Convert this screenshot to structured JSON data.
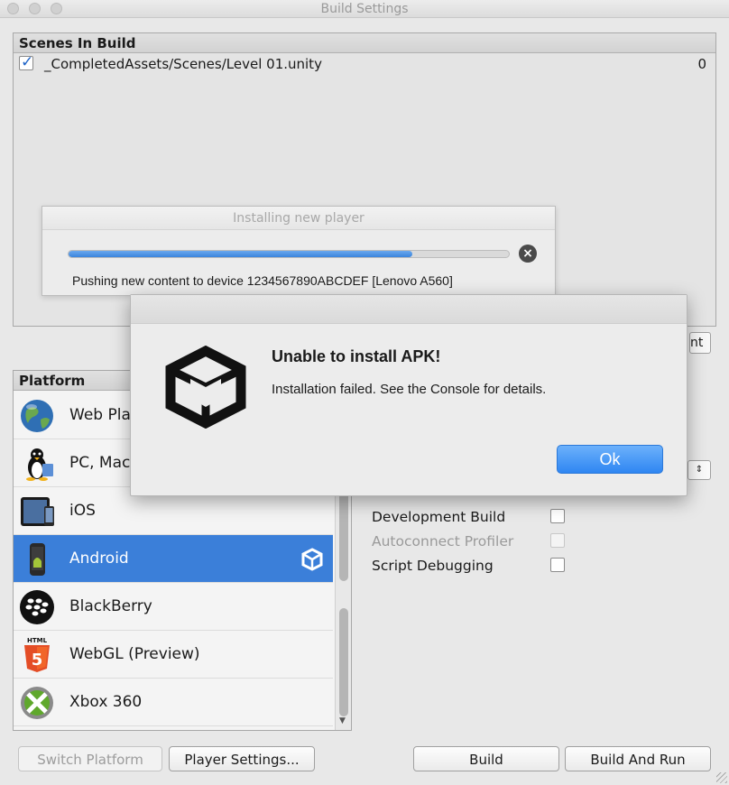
{
  "window": {
    "title": "Build Settings"
  },
  "scenes": {
    "header": "Scenes In Build",
    "items": [
      {
        "path": "_CompletedAssets/Scenes/Level 01.unity",
        "index": "0",
        "checked": true
      }
    ]
  },
  "progress_dialog": {
    "title": "Installing new player",
    "message": "Pushing new content to device 1234567890ABCDEF [Lenovo A560]",
    "progress_percent": 78
  },
  "platform": {
    "header": "Platform",
    "items": [
      {
        "label": "Web Pla",
        "icon": "globe-icon"
      },
      {
        "label": "PC, Mac",
        "icon": "penguin-icon"
      },
      {
        "label": "iOS",
        "icon": "ipad-icon"
      },
      {
        "label": "Android",
        "icon": "android-phone-icon",
        "selected": true
      },
      {
        "label": "BlackBerry",
        "icon": "blackberry-icon"
      },
      {
        "label": "WebGL (Preview)",
        "icon": "html5-icon",
        "badge": "HTML"
      },
      {
        "label": "Xbox 360",
        "icon": "xbox-icon"
      }
    ]
  },
  "options": [
    {
      "label": "Development Build",
      "checked": false,
      "disabled": false
    },
    {
      "label": "Autoconnect Profiler",
      "checked": false,
      "disabled": true
    },
    {
      "label": "Script Debugging",
      "checked": false,
      "disabled": false
    }
  ],
  "partial_button_text": "nt",
  "buttons": {
    "switch_platform": "Switch Platform",
    "player_settings": "Player Settings...",
    "build": "Build",
    "build_and_run": "Build And Run"
  },
  "alert": {
    "title": "Unable to install APK!",
    "message": "Installation failed. See the Console for details.",
    "ok_label": "Ok"
  },
  "colors": {
    "selection": "#3b7fd9",
    "ok_button": "#2f86f2",
    "progress": "#3a84dc"
  }
}
